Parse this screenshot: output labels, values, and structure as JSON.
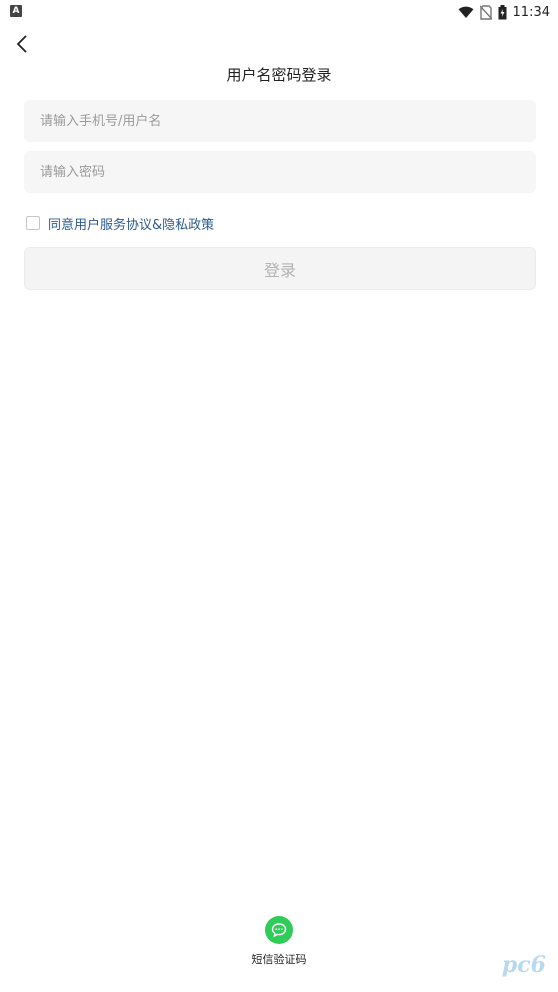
{
  "status_bar": {
    "left_badge": "A",
    "time": "11:34"
  },
  "header": {
    "title": "用户名密码登录"
  },
  "form": {
    "username_placeholder": "请输入手机号/用户名",
    "username_value": "",
    "password_placeholder": "请输入密码",
    "password_value": "",
    "agreement_text": "同意用户服务协议&隐私政策",
    "agreement_checked": false,
    "login_label": "登录"
  },
  "alt_login": {
    "sms_label": "短信验证码",
    "icon": "message-bubble-icon",
    "color": "#2fcc57"
  },
  "watermark": "pc6"
}
